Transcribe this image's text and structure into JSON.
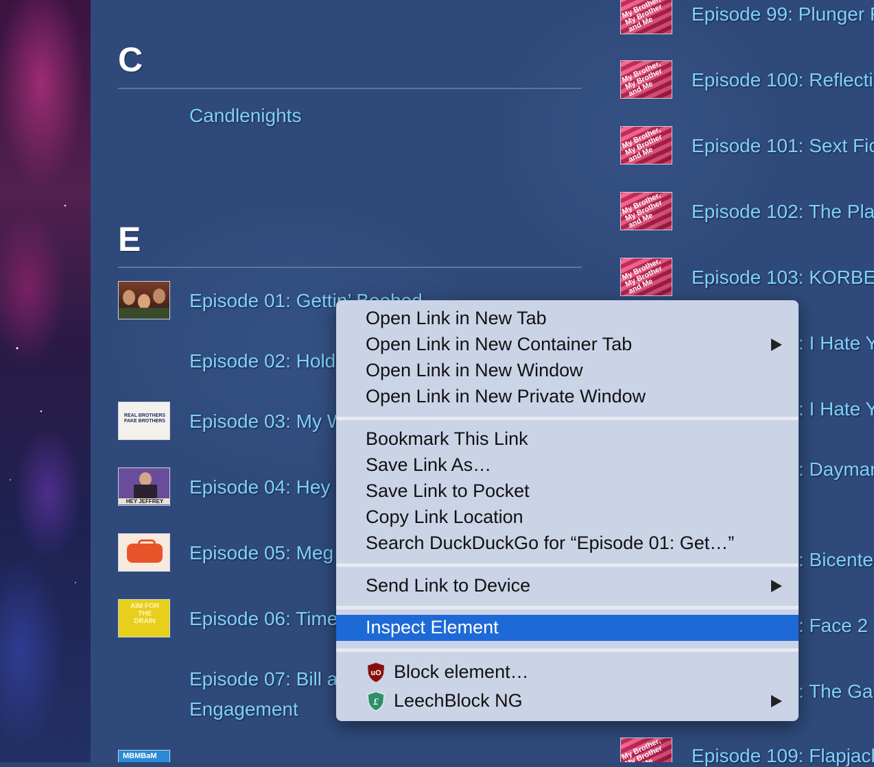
{
  "left_column": {
    "sections": [
      {
        "letter": "C",
        "items": [
          {
            "label": "Candlenights"
          }
        ]
      },
      {
        "letter": "E",
        "items": [
          {
            "label": "Episode 01: Gettin’ Beehed"
          },
          {
            "label": "Episode 02: Hold"
          },
          {
            "label": "Episode 03: My W"
          },
          {
            "label": "Episode 04: Hey"
          },
          {
            "label": "Episode 05: Meg"
          },
          {
            "label": "Episode 06: Time"
          },
          {
            "label": "Episode 07: Bill a",
            "line2": "Engagement"
          }
        ]
      }
    ],
    "thumb_texts": {
      "ep03": "REAL BROTHERS  FAKE BROTHERS",
      "ep04": "HEY JEFFREY",
      "ep06": "AIM FOR THE DRAIN",
      "bottom": "MBMBaM"
    }
  },
  "right_column": {
    "thumb_text": "My Brother, My Brother and Me",
    "items": [
      {
        "label": "Episode 99: Plunger F"
      },
      {
        "label": "Episode 100: Reflecti"
      },
      {
        "label": "Episode 101: Sext Fic"
      },
      {
        "label": "Episode 102: The Pla"
      },
      {
        "label": "Episode 103: KORBE"
      },
      {
        "label": ": I Hate Y"
      },
      {
        "label": ": I Hate Y"
      },
      {
        "label": ": Dayman"
      },
      {
        "label": ": Bicente"
      },
      {
        "label": ": Face 2"
      },
      {
        "label": ": The Gar"
      },
      {
        "label": "Episode 109: Flapjack"
      }
    ]
  },
  "context_menu": {
    "group1": [
      {
        "label": "Open Link in New Tab"
      },
      {
        "label": "Open Link in New Container Tab",
        "submenu": true
      },
      {
        "label": "Open Link in New Window"
      },
      {
        "label": "Open Link in New Private Window"
      }
    ],
    "group2": [
      {
        "label": "Bookmark This Link"
      },
      {
        "label": "Save Link As…"
      },
      {
        "label": "Save Link to Pocket"
      },
      {
        "label": "Copy Link Location"
      },
      {
        "label": "Search DuckDuckGo for “Episode 01: Get…”"
      }
    ],
    "group3": [
      {
        "label": "Send Link to Device",
        "submenu": true
      }
    ],
    "group4": [
      {
        "label": "Inspect Element",
        "highlighted": true
      }
    ],
    "group5": [
      {
        "label": "Block element…",
        "icon": "ublock-icon"
      },
      {
        "label": "LeechBlock NG",
        "icon": "leechblock-icon",
        "submenu": true
      }
    ],
    "highlight_color": "#1d6ad7"
  },
  "colors": {
    "link": "#7fd0ff",
    "background": "#2f4a7a"
  }
}
